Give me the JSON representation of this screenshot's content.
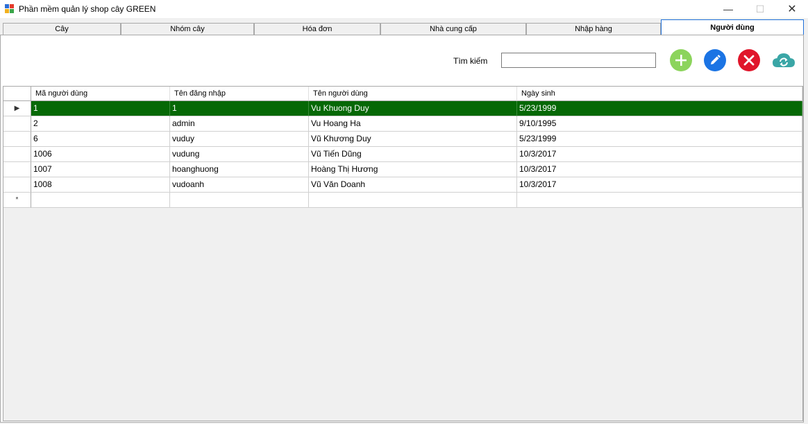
{
  "window": {
    "title": "Phần mềm quản lý shop cây GREEN",
    "min_glyph": "—",
    "max_glyph": "☐",
    "close_glyph": "✕"
  },
  "tabs": [
    {
      "label": "Cây",
      "active": false
    },
    {
      "label": "Nhóm cây",
      "active": false
    },
    {
      "label": "Hóa đơn",
      "active": false
    },
    {
      "label": "Nhà cung cấp",
      "active": false
    },
    {
      "label": "Nhập hàng",
      "active": false
    },
    {
      "label": "Người dùng",
      "active": true
    }
  ],
  "search": {
    "label": "Tìm kiếm",
    "value": "",
    "placeholder": ""
  },
  "actions": [
    {
      "name": "add-button",
      "icon": "plus-icon",
      "color": "#8cd45c"
    },
    {
      "name": "edit-button",
      "icon": "pencil-icon",
      "color": "#1b74e4"
    },
    {
      "name": "delete-button",
      "icon": "close-icon",
      "color": "#e0162b"
    },
    {
      "name": "refresh-button",
      "icon": "cloud-sync-icon",
      "color": "#3aa6a6"
    }
  ],
  "grid": {
    "columns": [
      "Mã người dùng",
      "Tên đăng nhập",
      "Tên người dùng",
      "Ngày sinh"
    ],
    "rows": [
      [
        "1",
        "1",
        "Vu Khuong Duy",
        "5/23/1999"
      ],
      [
        "2",
        "admin",
        "Vu Hoang Ha",
        "9/10/1995"
      ],
      [
        "6",
        "vuduy",
        "Vũ Khương Duy",
        "5/23/1999"
      ],
      [
        "1006",
        "vudung",
        "Vũ Tiến Dũng",
        "10/3/2017"
      ],
      [
        "1007",
        "hoanghuong",
        "Hoàng Thị Hương",
        "10/3/2017"
      ],
      [
        "1008",
        "vudoanh",
        "Vũ Văn Doanh",
        "10/3/2017"
      ]
    ],
    "selected_row": 0,
    "current_row_marker": "▶",
    "new_row_marker": "*",
    "selected_color": "#066806"
  }
}
